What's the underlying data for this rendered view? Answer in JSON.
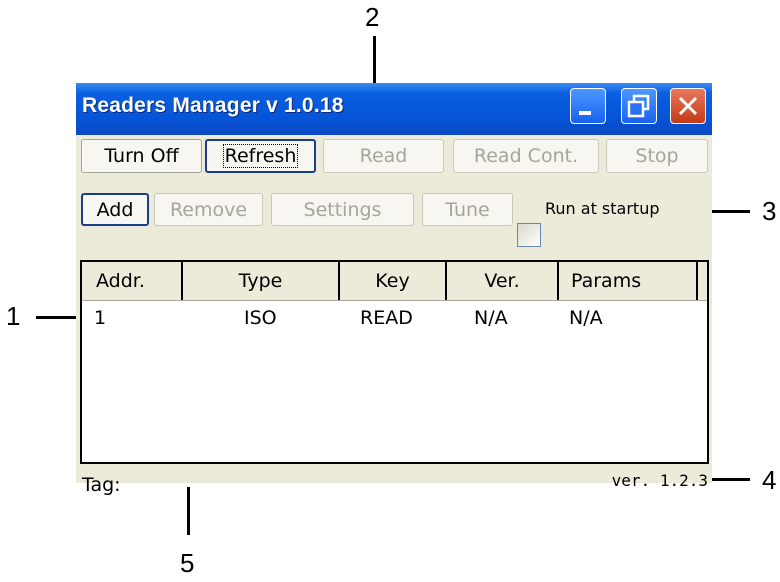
{
  "window": {
    "title": "Readers Manager v 1.0.18",
    "controls": [
      "minimize-icon",
      "restore-icon",
      "close-icon"
    ]
  },
  "toolbar1": {
    "turn_off": "Turn Off",
    "refresh": "Refresh",
    "read": "Read",
    "read_cont": "Read Cont.",
    "stop": "Stop"
  },
  "toolbar2": {
    "add": "Add",
    "remove": "Remove",
    "settings": "Settings",
    "tune": "Tune",
    "run_at_startup": "Run at startup"
  },
  "table": {
    "columns": [
      "Addr.",
      "Type",
      "Key",
      "Ver.",
      "Params"
    ],
    "rows": [
      [
        "1",
        "ISO",
        "READ",
        "N/A",
        "N/A"
      ]
    ]
  },
  "status": {
    "tag_label": "Tag:",
    "version": "ver.  1.2.3"
  },
  "callouts": {
    "c1": "1",
    "c2": "2",
    "c3": "3",
    "c4": "4",
    "c5": "5"
  },
  "colors": {
    "titlebar": "#0653d6",
    "window_bg": "#ecead8",
    "close_button": "#c23a17"
  }
}
